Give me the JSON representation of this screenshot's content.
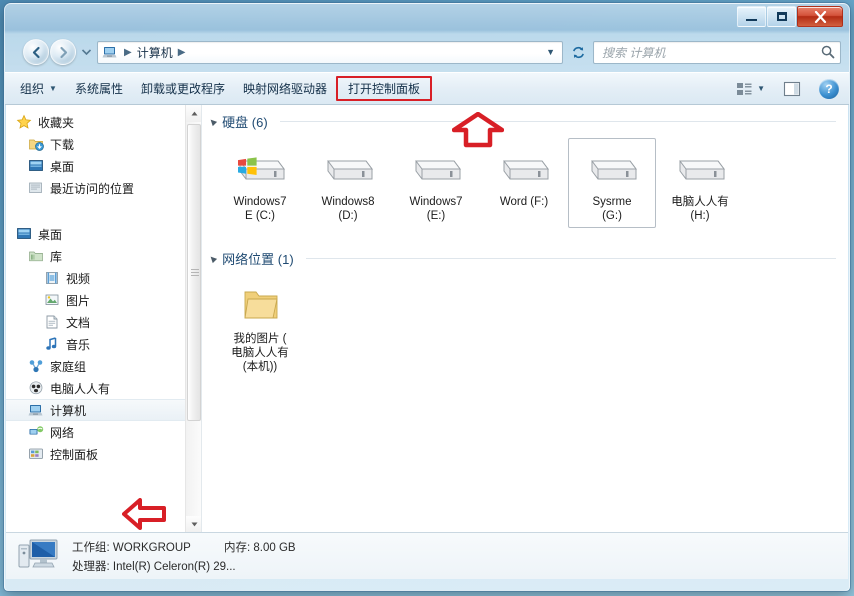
{
  "window": {
    "minimize_label": "最小化",
    "maximize_label": "最大化",
    "close_label": "关闭"
  },
  "nav": {
    "back_label": "后退",
    "forward_label": "前进",
    "recent_pages_label": "最近浏览的页面",
    "breadcrumb": [
      "计算机"
    ],
    "refresh_label": "刷新"
  },
  "search": {
    "placeholder": "搜索 计算机"
  },
  "toolbar": {
    "items": [
      {
        "label": "组织",
        "caret": "▼",
        "highlight": false
      },
      {
        "label": "系统属性",
        "caret": "",
        "highlight": false
      },
      {
        "label": "卸载或更改程序",
        "caret": "",
        "highlight": false
      },
      {
        "label": "映射网络驱动器",
        "caret": "",
        "highlight": false
      },
      {
        "label": "打开控制面板",
        "caret": "",
        "highlight": true
      }
    ],
    "view_label": "更改您的视图",
    "view_caret": "▼",
    "preview_label": "显示预览窗格",
    "help_label": "?"
  },
  "sidebar": {
    "groups": [
      {
        "items": [
          {
            "label": "收藏夹",
            "icon": "star-icon",
            "indent": 0,
            "selected": false
          },
          {
            "label": "下载",
            "icon": "downloads-icon",
            "indent": 1,
            "selected": false
          },
          {
            "label": "桌面",
            "icon": "desktop-icon",
            "indent": 1,
            "selected": false
          },
          {
            "label": "最近访问的位置",
            "icon": "recent-places-icon",
            "indent": 1,
            "selected": false
          }
        ]
      },
      {
        "items": [
          {
            "label": "桌面",
            "icon": "desktop-icon",
            "indent": 0,
            "selected": false
          },
          {
            "label": "库",
            "icon": "library-icon",
            "indent": 1,
            "selected": false
          },
          {
            "label": "视频",
            "icon": "videos-icon",
            "indent": 2,
            "selected": false
          },
          {
            "label": "图片",
            "icon": "pictures-icon",
            "indent": 2,
            "selected": false
          },
          {
            "label": "文档",
            "icon": "documents-icon",
            "indent": 2,
            "selected": false
          },
          {
            "label": "音乐",
            "icon": "music-icon",
            "indent": 2,
            "selected": false
          },
          {
            "label": "家庭组",
            "icon": "homegroup-icon",
            "indent": 1,
            "selected": false
          },
          {
            "label": "电脑人人有",
            "icon": "user-icon",
            "indent": 1,
            "selected": false
          },
          {
            "label": "计算机",
            "icon": "computer-icon",
            "indent": 1,
            "selected": true
          },
          {
            "label": "网络",
            "icon": "network-icon",
            "indent": 1,
            "selected": false
          },
          {
            "label": "控制面板",
            "icon": "control-panel-icon",
            "indent": 1,
            "selected": false
          }
        ]
      }
    ]
  },
  "main": {
    "sections": [
      {
        "title": "硬盘 (6)",
        "kind": "drives",
        "items": [
          {
            "name_line1": "Windows7",
            "name_line2": "E (C:)",
            "icon": "system-drive-icon",
            "selected": false
          },
          {
            "name_line1": "Windows8",
            "name_line2": "(D:)",
            "icon": "drive-icon",
            "selected": false
          },
          {
            "name_line1": "Windows7",
            "name_line2": "(E:)",
            "icon": "drive-icon",
            "selected": false
          },
          {
            "name_line1": "Word (F:)",
            "name_line2": "",
            "icon": "drive-icon",
            "selected": false
          },
          {
            "name_line1": "Sysrme",
            "name_line2": "(G:)",
            "icon": "drive-icon",
            "selected": true
          },
          {
            "name_line1": "电脑人人有",
            "name_line2": "(H:)",
            "icon": "drive-icon",
            "selected": false
          }
        ]
      },
      {
        "title": "网络位置 (1)",
        "kind": "network",
        "items": [
          {
            "name_line1": "我的图片 (",
            "name_line2": "电脑人人有",
            "name_line3": "(本机))",
            "icon": "folder-icon",
            "selected": false
          }
        ]
      }
    ]
  },
  "status": {
    "icon": "computer-icon",
    "rows": [
      {
        "left": "工作组: WORKGROUP",
        "right": "内存: 8.00 GB"
      },
      {
        "left": "处理器: Intel(R) Celeron(R) 29...",
        "right": ""
      }
    ]
  },
  "annotations": {
    "arrow_up_target": "打开控制面板",
    "arrow_left_target": "控制面板",
    "color": "#d81f26"
  }
}
